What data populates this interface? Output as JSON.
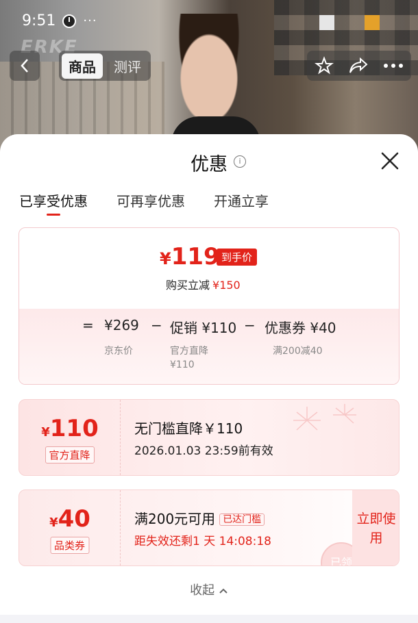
{
  "status": {
    "time": "9:51",
    "more": "···"
  },
  "topnav": {
    "brand": "ERKE",
    "tabs": [
      {
        "label": "商品",
        "active": true
      },
      {
        "label": "测评",
        "active": false
      }
    ],
    "icons": [
      "back-icon",
      "star-icon",
      "share-icon",
      "more-icon"
    ]
  },
  "sheet": {
    "title": "优惠",
    "tabs": [
      {
        "label": "已享受优惠",
        "active": true
      },
      {
        "label": "可再享优惠",
        "active": false
      },
      {
        "label": "开通立享",
        "active": false
      }
    ],
    "summary": {
      "final_yen": "¥",
      "final_price": "119",
      "final_badge": "到手价",
      "buy_reduce_label": "购买立减",
      "buy_reduce_amount": "¥150",
      "eq": "=",
      "items": [
        {
          "label": "¥269",
          "sub1": "京东价",
          "sub2": ""
        },
        {
          "label": "促销 ¥110",
          "sub1": "官方直降",
          "sub2": "¥110"
        },
        {
          "label": "优惠券 ¥40",
          "sub1": "满200减40",
          "sub2": ""
        }
      ],
      "minus": "−"
    },
    "coupons": [
      {
        "yen": "¥",
        "amount": "110",
        "tag": "官方直降",
        "title": "无门槛直降￥110",
        "sub": "2026.01.03 23:59前有效"
      },
      {
        "yen": "¥",
        "amount": "40",
        "tag": "品类券",
        "title": "满200元可用",
        "threshold": "已达门槛",
        "sub": "距失效还剩1 天 14:08:18",
        "action": "立即使用",
        "stamp": "已领"
      }
    ],
    "collapse": "收起"
  },
  "colors": {
    "accent": "#e2231a",
    "card_bg": "#fdeaea"
  }
}
